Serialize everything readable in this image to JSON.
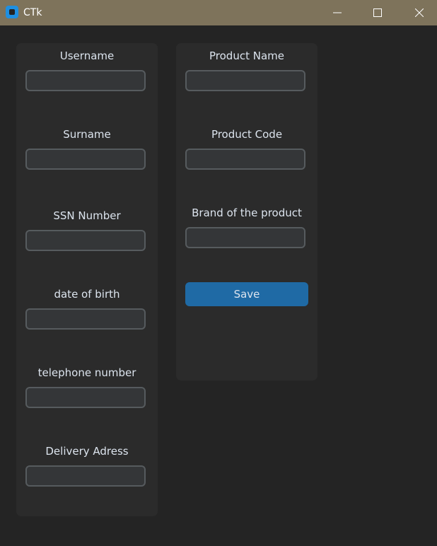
{
  "window": {
    "title": "CTk",
    "icon": "ctk-app-icon",
    "controls": [
      "minimize-icon",
      "maximize-icon",
      "close-icon"
    ]
  },
  "customer_form": {
    "username_label": "Username",
    "username_value": "",
    "surname_label": "Surname",
    "surname_value": "",
    "ssn_label": "SSN Number",
    "ssn_value": "",
    "dob_label": "date of birth",
    "dob_value": "",
    "phone_label": "telephone number",
    "phone_value": "",
    "address_label": "Delivery Adress",
    "address_value": ""
  },
  "product_form": {
    "name_label": "Product Name",
    "name_value": "",
    "code_label": "Product Code",
    "code_value": "",
    "brand_label": "Brand of the product",
    "brand_value": "",
    "save_label": "Save"
  },
  "colors": {
    "titlebar": "#7e735b",
    "background": "#242424",
    "panel": "#2b2b2b",
    "entry_fill": "#343638",
    "entry_border": "#565b5e",
    "text": "#dce4ee",
    "accent": "#1f6aa5"
  }
}
